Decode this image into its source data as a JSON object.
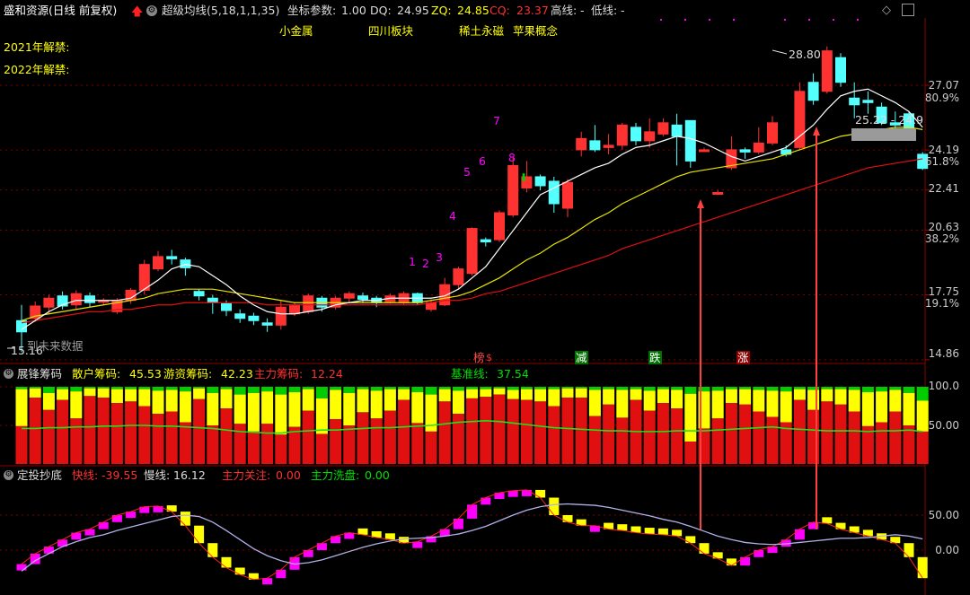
{
  "header": {
    "title": "盛和资源(日线 前复权)",
    "indicator_name": "超级均线(5,18,1,1,35)",
    "coord_label": "坐标参数:",
    "coord_value": "1.00",
    "dq_label": "DQ:",
    "dq_value": "24.95",
    "zq_label": "ZQ:",
    "zq_value": "24.85",
    "cq_label": "CQ:",
    "cq_value": "23.37",
    "high_label": "高线:",
    "high_value": "-",
    "low_label": "低线:",
    "low_value": "-"
  },
  "tags": [
    "小金属",
    "四川板块",
    "稀土永磁",
    "苹果概念"
  ],
  "notes": [
    "2021年解禁:",
    "2022年解禁:"
  ],
  "price_axis": {
    "ticks": [
      "27.07",
      "24.19",
      "22.41",
      "20.63",
      "17.75",
      "14.86"
    ],
    "pct_ticks": [
      "80.9%",
      "61.8%",
      "38.2%",
      "19.1%"
    ]
  },
  "price_labels": {
    "high": "28.80",
    "last": "25.22 - 24.9",
    "low": "15.16",
    "data_hint": "到未来数据"
  },
  "seq_numbers": [
    "1",
    "2",
    "3",
    "4",
    "5",
    "6",
    "7",
    "8"
  ],
  "signals": [
    "榜",
    "减",
    "跌",
    "涨"
  ],
  "panel2": {
    "title": "展锋筹码",
    "retail_label": "散户筹码:",
    "retail_value": "45.53",
    "hot_label": "游资筹码:",
    "hot_value": "42.23",
    "main_label": "主力筹码:",
    "main_value": "12.24",
    "base_label": "基准线:",
    "base_value": "37.54",
    "ticks": [
      "100.0",
      "50.00"
    ]
  },
  "panel3": {
    "title": "定投抄底",
    "fast_label": "快线:",
    "fast_value": "-39.55",
    "slow_label": "慢线:",
    "slow_value": "16.12",
    "focus_label": "主力关注:",
    "focus_value": "0.00",
    "wash_label": "主力洗盘:",
    "wash_value": "0.00",
    "ticks": [
      "50.00",
      "0.00"
    ]
  },
  "colors": {
    "up": "#ff3232",
    "down": "#54ffff",
    "ma5": "#ffffff",
    "ma18": "#e6e600",
    "ma35": "#e01010",
    "magenta": "#ff00ff",
    "yellow": "#ffff00",
    "green": "#00cc00",
    "grid": "#7a0000"
  },
  "chart_data": {
    "type": "candlestick",
    "candles": [
      [
        16.6,
        16.1,
        17.3,
        15.2
      ],
      [
        16.7,
        17.25,
        17.45,
        16.55
      ],
      [
        17.2,
        17.6,
        17.75,
        16.9
      ],
      [
        17.7,
        17.25,
        17.9,
        17.1
      ],
      [
        17.3,
        17.8,
        17.95,
        17.1
      ],
      [
        17.7,
        17.4,
        17.85,
        17.2
      ],
      [
        17.5,
        17.5,
        17.6,
        17.3
      ],
      [
        17.0,
        17.5,
        17.6,
        16.9
      ],
      [
        17.5,
        17.95,
        18.05,
        17.35
      ],
      [
        17.95,
        19.1,
        19.3,
        17.75
      ],
      [
        18.9,
        19.45,
        19.7,
        18.8
      ],
      [
        19.45,
        19.35,
        19.75,
        19.1
      ],
      [
        19.3,
        18.95,
        19.4,
        18.6
      ],
      [
        17.9,
        17.7,
        18.0,
        17.5
      ],
      [
        17.6,
        17.4,
        17.75,
        16.9
      ],
      [
        17.35,
        17.05,
        17.5,
        16.8
      ],
      [
        16.9,
        16.7,
        17.1,
        16.5
      ],
      [
        16.8,
        16.6,
        16.95,
        16.4
      ],
      [
        16.5,
        16.4,
        16.7,
        16.1
      ],
      [
        16.4,
        17.2,
        17.5,
        16.2
      ],
      [
        16.9,
        17.3,
        17.4,
        16.8
      ],
      [
        17.0,
        17.7,
        17.8,
        16.9
      ],
      [
        17.6,
        17.2,
        17.7,
        17.0
      ],
      [
        17.2,
        17.6,
        17.7,
        17.1
      ],
      [
        17.6,
        17.8,
        17.9,
        17.4
      ],
      [
        17.7,
        17.55,
        17.85,
        17.4
      ],
      [
        17.6,
        17.4,
        17.7,
        17.2
      ],
      [
        17.45,
        17.7,
        17.8,
        17.35
      ],
      [
        17.4,
        17.8,
        17.9,
        17.3
      ],
      [
        17.8,
        17.4,
        17.85,
        17.3
      ],
      [
        17.1,
        17.4,
        17.55,
        17.0
      ],
      [
        17.3,
        18.2,
        18.5,
        17.25
      ],
      [
        18.2,
        18.9,
        19.0,
        18.0
      ],
      [
        18.7,
        20.7,
        20.75,
        18.6
      ],
      [
        20.2,
        20.1,
        20.3,
        19.9
      ],
      [
        20.2,
        21.4,
        21.5,
        20.1
      ],
      [
        21.3,
        23.5,
        23.9,
        21.2
      ],
      [
        22.5,
        23.0,
        23.7,
        22.3
      ],
      [
        23.0,
        22.6,
        23.1,
        22.4
      ],
      [
        22.8,
        21.8,
        23.0,
        21.4
      ],
      [
        21.6,
        22.75,
        22.9,
        21.2
      ],
      [
        24.2,
        24.7,
        25.0,
        23.9
      ],
      [
        24.6,
        24.2,
        25.3,
        24.1
      ],
      [
        24.3,
        24.4,
        24.9,
        24.0
      ],
      [
        24.4,
        25.3,
        25.4,
        24.2
      ],
      [
        25.2,
        24.6,
        25.4,
        24.4
      ],
      [
        24.6,
        25.0,
        25.6,
        24.3
      ],
      [
        24.9,
        25.4,
        25.6,
        24.8
      ],
      [
        25.3,
        24.8,
        25.8,
        23.5
      ],
      [
        25.5,
        23.7,
        25.5,
        23.4
      ],
      [
        24.2,
        24.2,
        24.3,
        24.1
      ],
      [
        22.3,
        22.3,
        22.4,
        22.2
      ],
      [
        23.4,
        24.2,
        24.8,
        23.3
      ],
      [
        24.2,
        24.1,
        24.3,
        23.8
      ],
      [
        24.1,
        24.5,
        25.2,
        24.0
      ],
      [
        24.5,
        25.4,
        25.7,
        24.4
      ],
      [
        24.2,
        24.0,
        24.4,
        23.9
      ],
      [
        24.3,
        26.8,
        27.2,
        24.2
      ],
      [
        27.2,
        26.4,
        27.6,
        26.2
      ],
      [
        26.8,
        28.6,
        28.8,
        26.7
      ],
      [
        28.3,
        27.2,
        28.5,
        27.0
      ],
      [
        26.5,
        26.2,
        27.2,
        25.6
      ],
      [
        26.4,
        26.3,
        26.8,
        25.8
      ],
      [
        26.1,
        25.4,
        26.3,
        25.3
      ],
      [
        25.4,
        25.3,
        25.9,
        25.1
      ],
      [
        25.8,
        24.95,
        25.9,
        24.8
      ],
      [
        24.0,
        23.37,
        24.1,
        23.3
      ]
    ],
    "ma5": [
      16.2,
      16.6,
      17.0,
      17.3,
      17.5,
      17.5,
      17.5,
      17.5,
      17.6,
      18.0,
      18.4,
      18.9,
      19.1,
      19.0,
      18.6,
      18.2,
      17.7,
      17.3,
      17.0,
      16.9,
      16.9,
      17.0,
      17.1,
      17.3,
      17.4,
      17.5,
      17.5,
      17.6,
      17.6,
      17.6,
      17.6,
      17.7,
      18.0,
      18.5,
      19.0,
      19.8,
      20.6,
      21.4,
      22.2,
      22.5,
      22.8,
      23.1,
      23.4,
      23.6,
      24.0,
      24.3,
      24.4,
      24.6,
      24.8,
      24.7,
      24.5,
      24.2,
      23.9,
      23.7,
      23.9,
      24.1,
      24.3,
      24.8,
      25.3,
      26.0,
      26.6,
      26.8,
      26.9,
      26.6,
      26.3,
      25.9,
      25.2
    ],
    "ma18": [
      16.6,
      16.8,
      16.9,
      17.0,
      17.1,
      17.2,
      17.3,
      17.4,
      17.5,
      17.6,
      17.8,
      17.9,
      18.0,
      18.0,
      18.0,
      17.9,
      17.8,
      17.7,
      17.6,
      17.5,
      17.4,
      17.4,
      17.4,
      17.4,
      17.4,
      17.4,
      17.4,
      17.4,
      17.4,
      17.4,
      17.5,
      17.6,
      17.7,
      17.9,
      18.2,
      18.5,
      18.9,
      19.3,
      19.6,
      20.0,
      20.3,
      20.7,
      21.1,
      21.4,
      21.8,
      22.1,
      22.4,
      22.7,
      23.0,
      23.2,
      23.3,
      23.4,
      23.5,
      23.6,
      23.7,
      23.8,
      24.0,
      24.2,
      24.4,
      24.6,
      24.8,
      24.9,
      25.0,
      25.1,
      25.2,
      25.2,
      25.1
    ],
    "ma35": [
      16.5,
      16.6,
      16.7,
      16.8,
      16.9,
      17.0,
      17.0,
      17.1,
      17.1,
      17.2,
      17.3,
      17.3,
      17.4,
      17.4,
      17.4,
      17.4,
      17.4,
      17.4,
      17.3,
      17.3,
      17.3,
      17.3,
      17.3,
      17.3,
      17.3,
      17.3,
      17.3,
      17.3,
      17.3,
      17.3,
      17.4,
      17.5,
      17.5,
      17.6,
      17.8,
      17.9,
      18.1,
      18.3,
      18.5,
      18.7,
      18.9,
      19.1,
      19.3,
      19.5,
      19.8,
      20.0,
      20.2,
      20.4,
      20.6,
      20.8,
      21.0,
      21.2,
      21.4,
      21.6,
      21.8,
      22.0,
      22.2,
      22.4,
      22.6,
      22.8,
      23.0,
      23.2,
      23.4,
      23.5,
      23.6,
      23.7,
      23.8
    ],
    "chips_green": [
      3,
      2,
      8,
      3,
      6,
      2,
      2,
      3,
      3,
      3,
      5,
      4,
      6,
      2,
      8,
      3,
      10,
      8,
      6,
      10,
      7,
      3,
      15,
      4,
      8,
      3,
      5,
      3,
      3,
      7,
      10,
      3,
      5,
      3,
      3,
      2,
      4,
      3,
      3,
      3,
      2,
      2,
      4,
      3,
      4,
      3,
      5,
      3,
      4,
      9,
      6,
      5,
      3,
      3,
      4,
      5,
      6,
      3,
      4,
      3,
      3,
      4,
      7,
      6,
      4,
      8,
      18
    ],
    "chips_yellow": [
      48,
      12,
      22,
      14,
      35,
      10,
      12,
      18,
      16,
      22,
      30,
      28,
      40,
      14,
      42,
      25,
      38,
      50,
      42,
      52,
      45,
      28,
      46,
      38,
      42,
      30,
      36,
      28,
      14,
      40,
      48,
      16,
      30,
      12,
      10,
      8,
      12,
      14,
      16,
      22,
      12,
      12,
      34,
      20,
      36,
      14,
      26,
      18,
      24,
      62,
      48,
      36,
      18,
      20,
      28,
      34,
      40,
      14,
      26,
      16,
      20,
      28,
      44,
      40,
      28,
      42,
      40
    ],
    "chips_base": [
      46,
      46,
      47,
      47,
      48,
      48,
      49,
      49,
      50,
      50,
      49,
      49,
      48,
      47,
      46,
      44,
      42,
      41,
      40,
      40,
      42,
      43,
      44,
      44,
      45,
      46,
      47,
      47,
      48,
      49,
      50,
      52,
      54,
      55,
      56,
      55,
      53,
      51,
      49,
      47,
      46,
      45,
      44,
      43,
      43,
      42,
      42,
      42,
      43,
      43,
      43,
      44,
      45,
      46,
      47,
      48,
      46,
      45,
      44,
      43,
      43,
      43,
      42,
      43,
      43,
      44,
      42
    ],
    "fast_line": [
      -20,
      -5,
      5,
      15,
      25,
      30,
      40,
      50,
      55,
      62,
      63,
      55,
      35,
      10,
      -10,
      -25,
      -35,
      -42,
      -40,
      -28,
      -10,
      0,
      10,
      20,
      25,
      22,
      18,
      15,
      10,
      12,
      20,
      30,
      45,
      65,
      75,
      82,
      85,
      86,
      75,
      50,
      40,
      35,
      35,
      30,
      28,
      25,
      23,
      22,
      20,
      10,
      -5,
      -12,
      -22,
      -10,
      0,
      5,
      15,
      30,
      40,
      38,
      30,
      25,
      20,
      15,
      10,
      -10,
      -40
    ],
    "slow_line": [
      -30,
      -15,
      -5,
      5,
      12,
      18,
      22,
      28,
      33,
      38,
      43,
      48,
      50,
      48,
      40,
      28,
      15,
      2,
      -8,
      -15,
      -20,
      -18,
      -14,
      -8,
      -2,
      4,
      9,
      13,
      16,
      17,
      18,
      20,
      23,
      28,
      34,
      42,
      50,
      57,
      62,
      65,
      66,
      65,
      64,
      61,
      57,
      53,
      49,
      44,
      40,
      34,
      27,
      20,
      15,
      11,
      9,
      8,
      9,
      11,
      13,
      15,
      17,
      17,
      18,
      20,
      22,
      20,
      16
    ]
  }
}
